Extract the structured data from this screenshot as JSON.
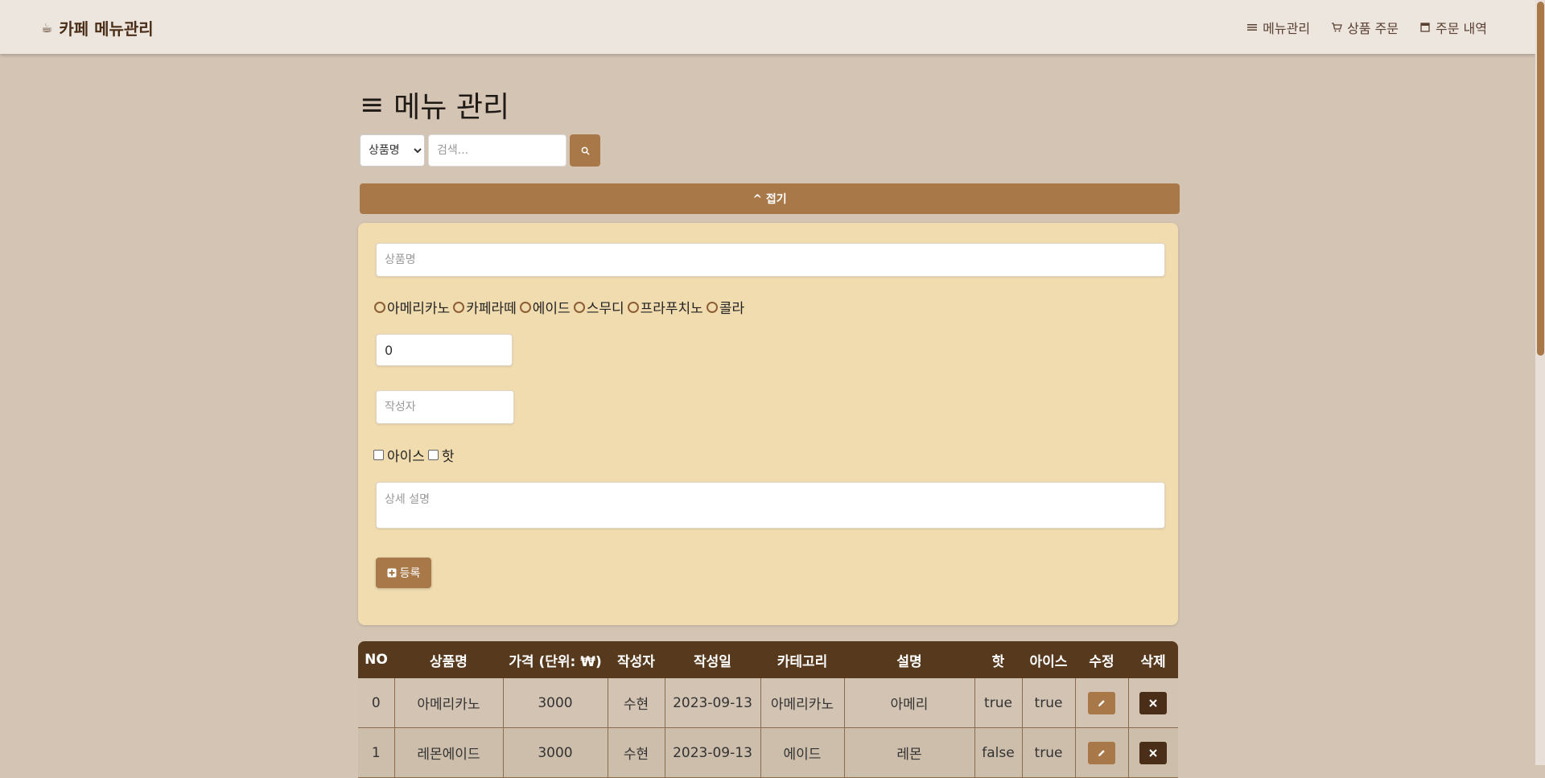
{
  "navbar": {
    "brand": "카페 메뉴관리",
    "links": [
      {
        "label": "메뉴관리"
      },
      {
        "label": "상품 주문"
      },
      {
        "label": "주문 내역"
      }
    ]
  },
  "page": {
    "title": "메뉴 관리"
  },
  "search": {
    "field_selected": "상품명",
    "placeholder": "검색..."
  },
  "collapse": {
    "label": "^ 접기"
  },
  "form": {
    "name_placeholder": "상품명",
    "categories": [
      "아메리카노",
      "카페라떼",
      "에이드",
      "스무디",
      "프라푸치노",
      "콜라"
    ],
    "price_value": "0",
    "writer_placeholder": "작성자",
    "checks": [
      "아이스",
      "핫"
    ],
    "desc_placeholder": "상세 설명",
    "submit_label": "등록"
  },
  "table": {
    "headers": [
      "NO",
      "상품명",
      "가격 (단위: ₩)",
      "작성자",
      "작성일",
      "카테고리",
      "설명",
      "핫",
      "아이스",
      "수정",
      "삭제"
    ],
    "rows": [
      {
        "no": "0",
        "name": "아메리카노",
        "price": "3000",
        "writer": "수현",
        "date": "2023-09-13",
        "category": "아메리카노",
        "desc": "아메리",
        "hot": "true",
        "ice": "true"
      },
      {
        "no": "1",
        "name": "레몬에이드",
        "price": "3000",
        "writer": "수현",
        "date": "2023-09-13",
        "category": "에이드",
        "desc": "레몬",
        "hot": "false",
        "ice": "true"
      }
    ]
  },
  "colors": {
    "background": "#d4c4b3",
    "accent": "#a87849",
    "dark": "#573a1e",
    "panel": "#f1dcb0"
  }
}
